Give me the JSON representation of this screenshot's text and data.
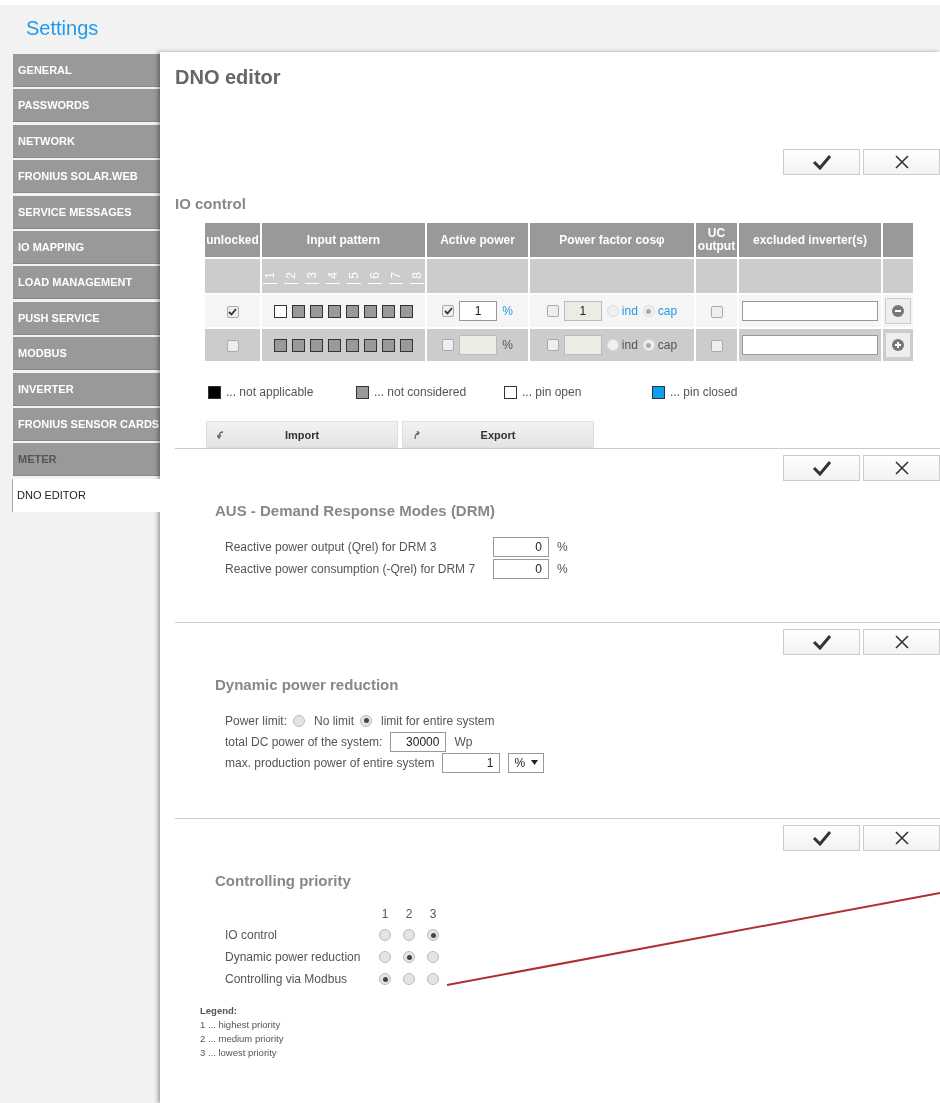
{
  "header": {
    "title": "Settings"
  },
  "sidebar": {
    "items": [
      {
        "label": "GENERAL",
        "selected": false,
        "disabled": false
      },
      {
        "label": "PASSWORDS",
        "selected": false,
        "disabled": false
      },
      {
        "label": "NETWORK",
        "selected": false,
        "disabled": false
      },
      {
        "label": "FRONIUS SOLAR.WEB",
        "selected": false,
        "disabled": false
      },
      {
        "label": "SERVICE MESSAGES",
        "selected": false,
        "disabled": false
      },
      {
        "label": "IO MAPPING",
        "selected": false,
        "disabled": false
      },
      {
        "label": "LOAD MANAGEMENT",
        "selected": false,
        "disabled": false
      },
      {
        "label": "PUSH SERVICE",
        "selected": false,
        "disabled": false
      },
      {
        "label": "MODBUS",
        "selected": false,
        "disabled": false
      },
      {
        "label": "INVERTER",
        "selected": false,
        "disabled": false
      },
      {
        "label": "FRONIUS SENSOR CARDS",
        "selected": false,
        "disabled": false
      },
      {
        "label": "METER",
        "selected": false,
        "disabled": true
      },
      {
        "label": "DNO EDITOR",
        "selected": true,
        "disabled": false
      }
    ]
  },
  "main": {
    "title": "DNO editor",
    "sections": [
      {
        "kind": "io_control",
        "title": "IO control",
        "table": {
          "columns": [
            "unlocked",
            "Input pattern",
            "Active power",
            "Power factor cosφ",
            "UC output",
            "excluded inverter(s)"
          ],
          "pin_labels": [
            "1",
            "2",
            "3",
            "4",
            "5",
            "6",
            "7",
            "8"
          ],
          "rows": [
            {
              "kind": "remove",
              "unlocked": true,
              "pins": [
                {
                  "kind": "open"
                },
                {
                  "kind": "not_considered"
                },
                {
                  "kind": "not_considered"
                },
                {
                  "kind": "not_considered"
                },
                {
                  "kind": "not_considered"
                },
                {
                  "kind": "not_considered"
                },
                {
                  "kind": "not_considered"
                },
                {
                  "kind": "not_considered"
                }
              ],
              "active_power": {
                "checked": true,
                "value": "1",
                "unit": "%"
              },
              "power_factor": {
                "checked": false,
                "value": "1",
                "options": [
                  {
                    "label": "ind",
                    "selected": false
                  },
                  {
                    "label": "cap",
                    "selected": true
                  }
                ]
              },
              "uc_output": false
            },
            {
              "kind": "add",
              "unlocked": false,
              "pins": [
                {
                  "kind": "not_considered"
                },
                {
                  "kind": "not_considered"
                },
                {
                  "kind": "not_considered"
                },
                {
                  "kind": "not_considered"
                },
                {
                  "kind": "not_considered"
                },
                {
                  "kind": "not_considered"
                },
                {
                  "kind": "not_considered"
                },
                {
                  "kind": "not_considered"
                }
              ],
              "active_power": {
                "checked": false,
                "unit": "%"
              },
              "power_factor": {
                "checked": false,
                "options": [
                  {
                    "label": "ind",
                    "selected": false
                  },
                  {
                    "label": "cap",
                    "selected": true
                  }
                ]
              },
              "uc_output": false
            }
          ]
        },
        "legend": [
          {
            "kind": "not_applicable",
            "label": "... not applicable"
          },
          {
            "kind": "not_considered",
            "label": "... not considered"
          },
          {
            "kind": "open",
            "label": "... pin open"
          },
          {
            "kind": "closed",
            "label": "... pin closed"
          }
        ],
        "buttons": [
          {
            "kind": "import",
            "label": "Import"
          },
          {
            "kind": "export",
            "label": "Export"
          }
        ]
      },
      {
        "kind": "drm",
        "title": "AUS - Demand Response Modes (DRM)",
        "rows": [
          {
            "label": "Reactive power output (Qrel) for DRM 3",
            "value": "0",
            "unit": "%"
          },
          {
            "label": "Reactive power consumption (-Qrel) for DRM 7",
            "value": "0",
            "unit": "%"
          }
        ]
      },
      {
        "kind": "dynamic",
        "title": "Dynamic power reduction",
        "power_limit": {
          "label": "Power limit:",
          "options": [
            {
              "label": "No limit",
              "selected": false
            },
            {
              "label": "limit for entire system",
              "selected": true
            }
          ]
        },
        "dc_power": {
          "label": "total DC power of the system:",
          "value": "30000",
          "unit": "Wp"
        },
        "max_production": {
          "label": "max. production power of entire system",
          "value": "1",
          "unit": "%"
        }
      },
      {
        "kind": "priority",
        "title": "Controlling priority",
        "columns": [
          "1",
          "2",
          "3"
        ],
        "rows": [
          {
            "label": "IO control",
            "options": [
              {
                "selected": false
              },
              {
                "selected": false
              },
              {
                "selected": true
              }
            ]
          },
          {
            "label": "Dynamic power reduction",
            "options": [
              {
                "selected": false
              },
              {
                "selected": true
              },
              {
                "selected": false
              }
            ]
          },
          {
            "label": "Controlling via Modbus",
            "options": [
              {
                "selected": true
              },
              {
                "selected": false
              },
              {
                "selected": false
              }
            ]
          }
        ],
        "legend": {
          "title": "Legend:",
          "lines": [
            "1 ... highest priority",
            "2 ... medium priority",
            "3 ... lowest priority"
          ]
        }
      }
    ]
  }
}
